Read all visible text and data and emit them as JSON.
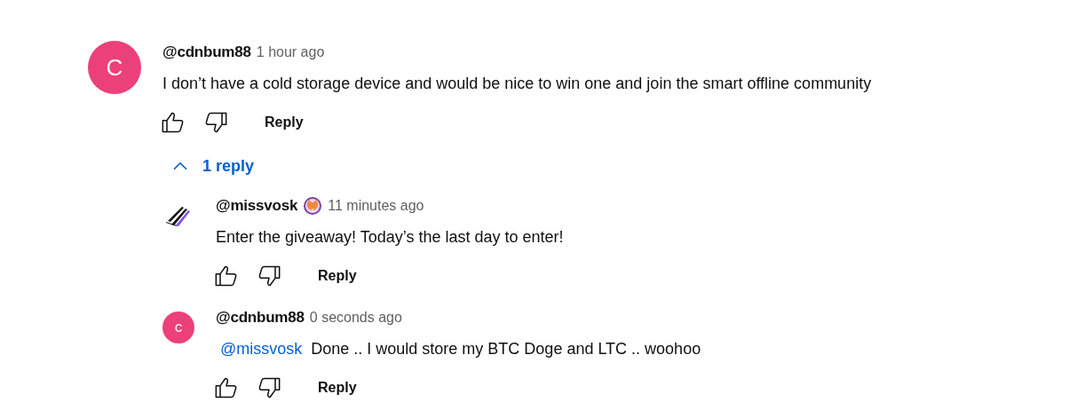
{
  "comment": {
    "avatar": {
      "kind": "letter",
      "letter": "C",
      "color": "#ec407a"
    },
    "author": "@cdnbum88",
    "time": "1 hour ago",
    "text": "I don’t have a cold storage device and would be nice to win one and join the smart offline community",
    "reply_label": "Reply"
  },
  "replies_toggle": {
    "label": "1 reply",
    "expanded": true
  },
  "replies": [
    {
      "avatar": {
        "kind": "logo"
      },
      "author": "@missvosk",
      "badge": true,
      "time": "11 minutes ago",
      "text": "Enter the giveaway! Today’s the last day to enter!",
      "reply_label": "Reply"
    },
    {
      "avatar": {
        "kind": "letter",
        "letter": "c",
        "color": "#ec407a"
      },
      "author": "@cdnbum88",
      "badge": false,
      "time": "0 seconds ago",
      "mention": "@missvosk",
      "text": "Done .. I would store my BTC Doge and LTC .. woohoo",
      "reply_label": "Reply"
    }
  ]
}
